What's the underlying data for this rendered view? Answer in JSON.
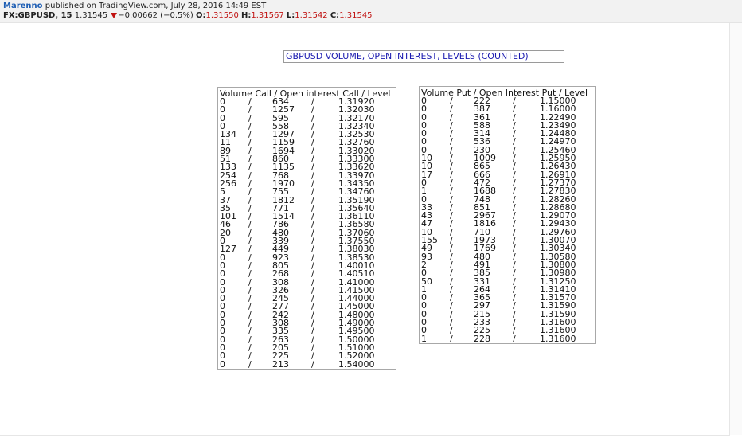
{
  "header": {
    "author": "Marenno",
    "published": "published on TradingView.com, July 28, 2016 14:49 EST",
    "symbol": "FX:GBPUSD, 15",
    "price": "1.31545",
    "change": "−0.00662 (−0.5%)",
    "open_label": "O:",
    "open": "1.31550",
    "high_label": "H:",
    "high": "1.31567",
    "low_label": "L:",
    "low": "1.31542",
    "close_label": "C:",
    "close": "1.31545"
  },
  "title": "GBPUSD VOLUME, OPEN INTEREST, LEVELS (COUNTED)",
  "call_table": {
    "header": "Volume Call / Open interest Call / Level",
    "rows": [
      [
        "0",
        "634",
        "1.31920"
      ],
      [
        "0",
        "1257",
        "1.32030"
      ],
      [
        "0",
        "595",
        "1.32170"
      ],
      [
        "0",
        "558",
        "1.32340"
      ],
      [
        "134",
        "1297",
        "1.32530"
      ],
      [
        "11",
        "1159",
        "1.32760"
      ],
      [
        "89",
        "1694",
        "1.33020"
      ],
      [
        "51",
        "860",
        "1.33300"
      ],
      [
        "133",
        "1135",
        "1.33620"
      ],
      [
        "254",
        "768",
        "1.33970"
      ],
      [
        "256",
        "1970",
        "1.34350"
      ],
      [
        "5",
        "755",
        "1.34760"
      ],
      [
        "37",
        "1812",
        "1.35190"
      ],
      [
        "35",
        "771",
        "1.35640"
      ],
      [
        "101",
        "1514",
        "1.36110"
      ],
      [
        "46",
        "786",
        "1.36580"
      ],
      [
        "20",
        "480",
        "1.37060"
      ],
      [
        "0",
        "339",
        "1.37550"
      ],
      [
        "127",
        "449",
        "1.38030"
      ],
      [
        "0",
        "923",
        "1.38530"
      ],
      [
        "0",
        "805",
        "1.40010"
      ],
      [
        "0",
        "268",
        "1.40510"
      ],
      [
        "0",
        "308",
        "1.41000"
      ],
      [
        "0",
        "326",
        "1.41500"
      ],
      [
        "0",
        "245",
        "1.44000"
      ],
      [
        "0",
        "277",
        "1.45000"
      ],
      [
        "0",
        "242",
        "1.48000"
      ],
      [
        "0",
        "308",
        "1.49000"
      ],
      [
        "0",
        "335",
        "1.49500"
      ],
      [
        "0",
        "263",
        "1.50000"
      ],
      [
        "0",
        "205",
        "1.51000"
      ],
      [
        "0",
        "225",
        "1.52000"
      ],
      [
        "0",
        "213",
        "1.54000"
      ]
    ]
  },
  "put_table": {
    "header": "Volume Put / Open Interest Put / Level",
    "rows": [
      [
        "0",
        "222",
        "1.15000"
      ],
      [
        "0",
        "387",
        "1.16000"
      ],
      [
        "0",
        "361",
        "1.22490"
      ],
      [
        "0",
        "588",
        "1.23490"
      ],
      [
        "0",
        "314",
        "1.24480"
      ],
      [
        "0",
        "536",
        "1.24970"
      ],
      [
        "0",
        "230",
        "1.25460"
      ],
      [
        "10",
        "1009",
        "1.25950"
      ],
      [
        "10",
        "865",
        "1.26430"
      ],
      [
        "17",
        "666",
        "1.26910"
      ],
      [
        "0",
        "472",
        "1.27370"
      ],
      [
        "1",
        "1688",
        "1.27830"
      ],
      [
        "0",
        "748",
        "1.28260"
      ],
      [
        "33",
        "851",
        "1.28680"
      ],
      [
        "43",
        "2967",
        "1.29070"
      ],
      [
        "47",
        "1816",
        "1.29430"
      ],
      [
        "10",
        "710",
        "1.29760"
      ],
      [
        "155",
        "1973",
        "1.30070"
      ],
      [
        "49",
        "1769",
        "1.30340"
      ],
      [
        "93",
        "480",
        "1.30580"
      ],
      [
        "2",
        "491",
        "1.30800"
      ],
      [
        "0",
        "385",
        "1.30980"
      ],
      [
        "50",
        "331",
        "1.31250"
      ],
      [
        "1",
        "264",
        "1.31410"
      ],
      [
        "0",
        "365",
        "1.31570"
      ],
      [
        "0",
        "297",
        "1.31590"
      ],
      [
        "0",
        "215",
        "1.31590"
      ],
      [
        "0",
        "233",
        "1.31600"
      ],
      [
        "0",
        "225",
        "1.31600"
      ],
      [
        "1",
        "228",
        "1.31600"
      ]
    ]
  },
  "separator": "/",
  "colors": {
    "author": "#1f5fb4",
    "down": "#c0100f",
    "title": "#1a1ab0"
  }
}
